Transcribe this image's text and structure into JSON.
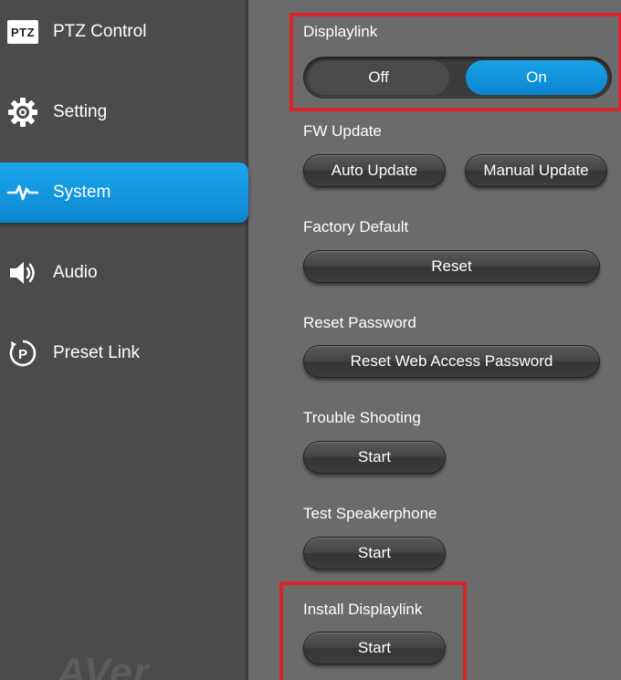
{
  "sidebar": {
    "items": [
      {
        "label": "PTZ Control",
        "icon": "ptz-icon",
        "badge": "PTZ"
      },
      {
        "label": "Setting",
        "icon": "gear-icon"
      },
      {
        "label": "System",
        "icon": "pulse-icon"
      },
      {
        "label": "Audio",
        "icon": "speaker-icon"
      },
      {
        "label": "Preset Link",
        "icon": "preset-link-icon"
      }
    ],
    "active": "System",
    "logo_text": "AVer"
  },
  "displaylink": {
    "label": "Displaylink",
    "off_label": "Off",
    "on_label": "On",
    "selected": "On"
  },
  "fw_update": {
    "label": "FW Update",
    "auto_label": "Auto Update",
    "manual_label": "Manual Update"
  },
  "factory_default": {
    "label": "Factory Default",
    "button_label": "Reset"
  },
  "reset_password": {
    "label": "Reset Password",
    "button_label": "Reset Web Access Password"
  },
  "trouble_shooting": {
    "label": "Trouble Shooting",
    "button_label": "Start"
  },
  "test_speakerphone": {
    "label": "Test Speakerphone",
    "button_label": "Start"
  },
  "install_displaylink": {
    "label": "Install Displaylink",
    "button_label": "Start"
  },
  "colors": {
    "accent": "#1aa7ee",
    "highlight": "#d8252c",
    "sidebar_bg": "#4b4b4b",
    "main_bg": "#6b6b6b"
  }
}
